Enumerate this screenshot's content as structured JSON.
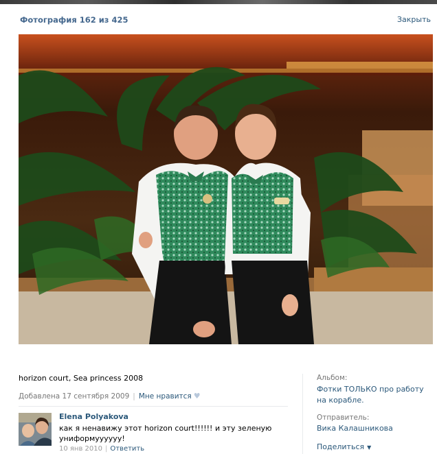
{
  "header": {
    "title": "Фотография 162 из 425",
    "close_label": "Закрыть"
  },
  "photo": {
    "caption": "horizon court, Sea princess 2008"
  },
  "meta": {
    "added": "Добавлена 17 сентября 2009",
    "like_label": "Мне нравится"
  },
  "comment": {
    "author": "Elena Polyakova",
    "text": "как я ненавижу этот horizon court!!!!!! и эту зеленую униформуууууу!",
    "date": "10 янв 2010",
    "reply_label": "Ответить"
  },
  "sidebar": {
    "album_label": "Альбом:",
    "album_name": "Фотки ТОЛЬКО про работу на корабле.",
    "sender_label": "Отправитель:",
    "sender_name": "Вика Калашникова",
    "share_label": "Поделиться"
  },
  "colors": {
    "link": "#2b587a",
    "title": "#45688e",
    "muted": "#777777"
  }
}
